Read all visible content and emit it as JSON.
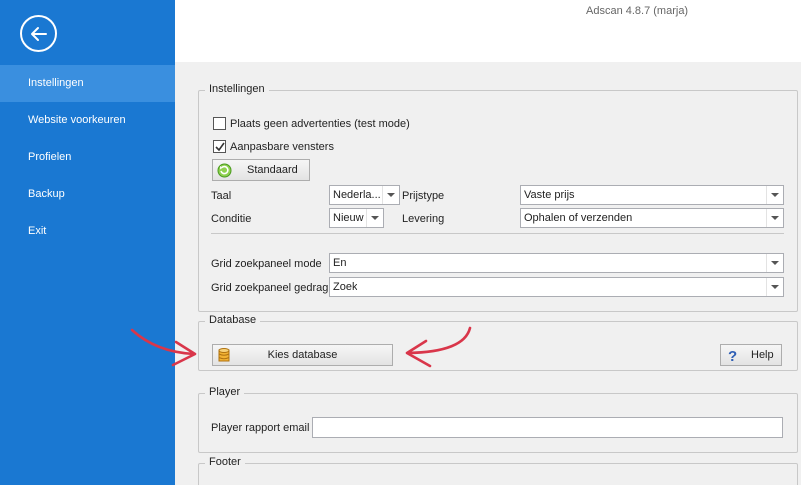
{
  "sidebar": {
    "items": [
      {
        "label": "Instellingen",
        "active": true
      },
      {
        "label": "Website voorkeuren"
      },
      {
        "label": "Profielen"
      },
      {
        "label": "Backup"
      },
      {
        "label": "Exit"
      }
    ]
  },
  "header": {
    "title": "Adscan 4.8.7 (marja)"
  },
  "instellingen": {
    "title": "Instellingen",
    "chk_no_ads": {
      "label": "Plaats geen advertenties (test mode)",
      "checked": false
    },
    "chk_windows": {
      "label": "Aanpasbare vensters",
      "checked": true
    },
    "standaard_button": "Standaard",
    "taal": {
      "label": "Taal",
      "value": "Nederla..."
    },
    "prijstype": {
      "label": "Prijstype",
      "value": "Vaste prijs"
    },
    "conditie": {
      "label": "Conditie",
      "value": "Nieuw"
    },
    "levering": {
      "label": "Levering",
      "value": "Ophalen of verzenden"
    },
    "grid_mode": {
      "label": "Grid zoekpaneel mode",
      "value": "En"
    },
    "grid_gedrag": {
      "label": "Grid zoekpaneel gedrag",
      "value": "Zoek"
    }
  },
  "database": {
    "title": "Database",
    "kies_button": "Kies database",
    "help_button": "Help"
  },
  "player": {
    "title": "Player",
    "email_label": "Player rapport email",
    "email_value": ""
  },
  "footer": {
    "title": "Footer"
  },
  "colors": {
    "sidebar": "#1a78d2",
    "sidebar_active": "#3a8fdf",
    "annotation_arrow": "#d9364a"
  }
}
